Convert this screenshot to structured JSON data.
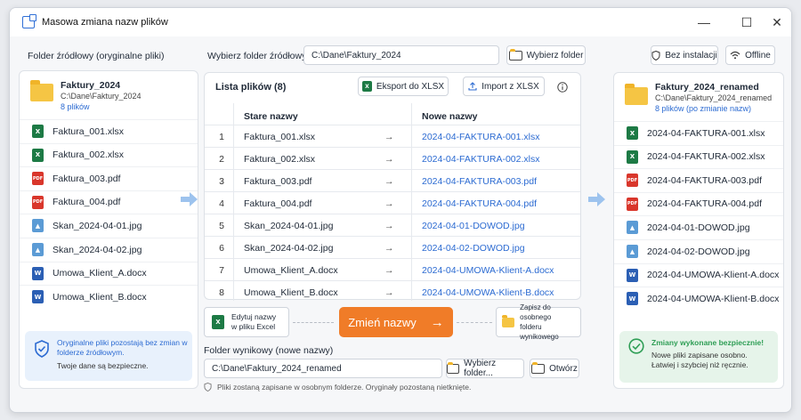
{
  "window": {
    "title": "Masowa zmiana nazw plików",
    "minimize": "—",
    "maximize": "☐",
    "close": "✕"
  },
  "source_panel": {
    "header": "Folder źródłowy (oryginalne pliki)",
    "folder_name": "Faktury_2024",
    "folder_path": "C:\\Dane\\Faktury_2024",
    "file_count": "8 plików",
    "files": [
      {
        "name": "Faktura_001.xlsx",
        "type": "xl"
      },
      {
        "name": "Faktura_002.xlsx",
        "type": "xl"
      },
      {
        "name": "Faktura_003.pdf",
        "type": "pdf"
      },
      {
        "name": "Faktura_004.pdf",
        "type": "pdf"
      },
      {
        "name": "Skan_2024-04-01.jpg",
        "type": "img"
      },
      {
        "name": "Skan_2024-04-02.jpg",
        "type": "img"
      },
      {
        "name": "Umowa_Klient_A.docx",
        "type": "doc"
      },
      {
        "name": "Umowa_Klient_B.docx",
        "type": "doc"
      }
    ],
    "note_title": "Oryginalne pliki pozostają bez zmian w folderze źródłowym.",
    "note_body": "Twoje dane są bezpieczne."
  },
  "top": {
    "choose_label": "Wybierz folder źródłowy:",
    "source_path": "C:\\Dane\\Faktury_2024",
    "choose_button": "Wybierz folder",
    "badge_install": "Bez instalacji",
    "badge_offline": "Offline"
  },
  "list": {
    "title": "Lista plików (8)",
    "export_button": "Eksport do XLSX",
    "import_button": "Import z XLSX",
    "col_old": "Stare nazwy",
    "col_new": "Nowe nazwy",
    "arrow": "→",
    "rows": [
      {
        "n": "1",
        "old": "Faktura_001.xlsx",
        "new": "2024-04-FAKTURA-001.xlsx"
      },
      {
        "n": "2",
        "old": "Faktura_002.xlsx",
        "new": "2024-04-FAKTURA-002.xlsx"
      },
      {
        "n": "3",
        "old": "Faktura_003.pdf",
        "new": "2024-04-FAKTURA-003.pdf"
      },
      {
        "n": "4",
        "old": "Faktura_004.pdf",
        "new": "2024-04-FAKTURA-004.pdf"
      },
      {
        "n": "5",
        "old": "Skan_2024-04-01.jpg",
        "new": "2024-04-01-DOWOD.jpg"
      },
      {
        "n": "6",
        "old": "Skan_2024-04-02.jpg",
        "new": "2024-04-02-DOWOD.jpg"
      },
      {
        "n": "7",
        "old": "Umowa_Klient_A.docx",
        "new": "2024-04-UMOWA-Klient-A.docx"
      },
      {
        "n": "8",
        "old": "Umowa_Klient_B.docx",
        "new": "2024-04-UMOWA-Klient-B.docx"
      }
    ]
  },
  "workflow": {
    "excel_line1": "Edytuj nazwy",
    "excel_line2": "w pliku Excel",
    "rename_button": "Zmień nazwy",
    "rename_arrow": "→",
    "save_line1": "Zapisz do osobnego",
    "save_line2": "folderu wynikowego"
  },
  "output": {
    "label": "Folder wynikowy (nowe nazwy)",
    "path": "C:\\Dane\\Faktury_2024_renamed",
    "choose_button": "Wybierz folder...",
    "open_button": "Otwórz",
    "footer_note": "Pliki zostaną zapisane w osobnym folderze. Oryginały pozostaną nietknięte."
  },
  "result_panel": {
    "folder_name": "Faktury_2024_renamed",
    "folder_path": "C:\\Dane\\Faktury_2024_renamed",
    "file_count": "8 plików (po zmianie nazw)",
    "files": [
      {
        "name": "2024-04-FAKTURA-001.xlsx",
        "type": "xl"
      },
      {
        "name": "2024-04-FAKTURA-002.xlsx",
        "type": "xl"
      },
      {
        "name": "2024-04-FAKTURA-003.pdf",
        "type": "pdf"
      },
      {
        "name": "2024-04-FAKTURA-004.pdf",
        "type": "pdf"
      },
      {
        "name": "2024-04-01-DOWOD.jpg",
        "type": "img"
      },
      {
        "name": "2024-04-02-DOWOD.jpg",
        "type": "img"
      },
      {
        "name": "2024-04-UMOWA-Klient-A.docx",
        "type": "doc"
      },
      {
        "name": "2024-04-UMOWA-Klient-B.docx",
        "type": "doc"
      }
    ],
    "success_title": "Zmiany wykonane bezpiecznie!",
    "success_line1": "Nowe pliki zapisane osobno.",
    "success_line2": "Łatwiej i szybciej niż ręcznie."
  },
  "colors": {
    "accent": "#2c6bd2",
    "rename": "#f07c28",
    "success": "#2e9e55"
  }
}
